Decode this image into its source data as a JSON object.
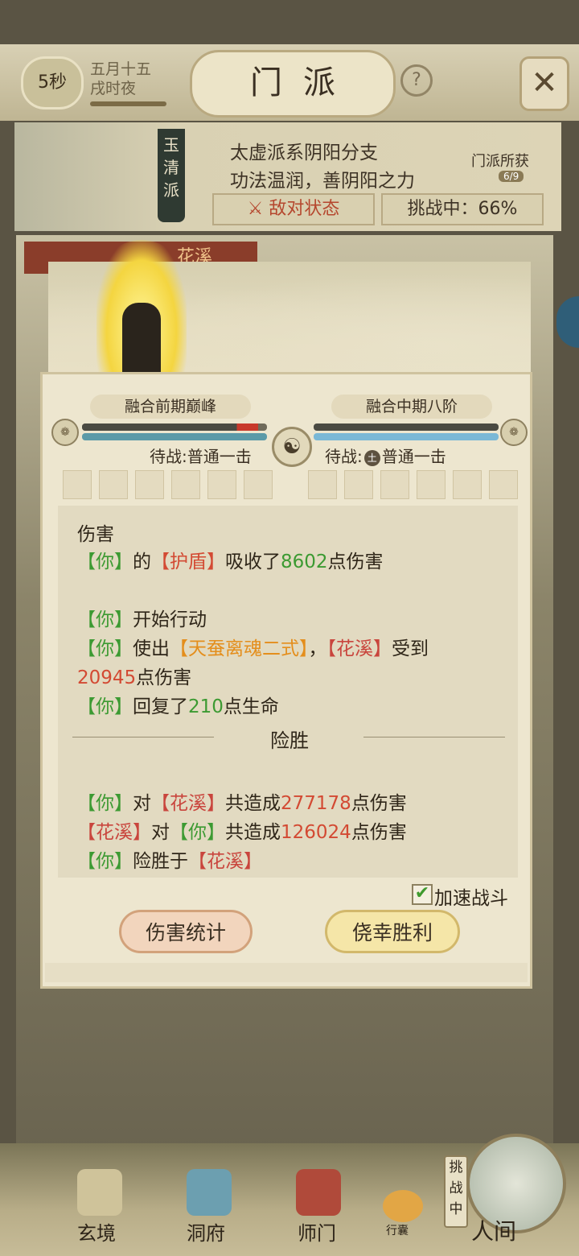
{
  "header": {
    "timer": "5秒",
    "date_line1": "五月十五",
    "date_line2": "戌时夜",
    "title": "门派",
    "help_label": "?",
    "close_label": "✕"
  },
  "sect": {
    "name_banner": "玉清派",
    "desc_line1": "太虚派系阴阳分支",
    "desc_line2": "功法温润，善阴阳之力",
    "reward_label": "门派所获",
    "reward_count": "6/9",
    "enemy_status": "敌对状态",
    "challenge_status": "挑战中：66%"
  },
  "enemy_tab": "花溪",
  "battle": {
    "left": {
      "realm": "融合前期巅峰",
      "avatar": "",
      "hp": 0.95,
      "mp": 1.0,
      "waiting": "待战:普通一击"
    },
    "right": {
      "realm": "融合中期八阶",
      "avatar": "",
      "hp": 1.0,
      "mp": 1.0,
      "waiting_prefix": "待战:",
      "waiting_tag": "土",
      "waiting_action": "普通一击"
    },
    "center_icon": "☯"
  },
  "log": {
    "l1": "伤害",
    "l2_a": "【你】",
    "l2_b": "的",
    "l2_c": "【护盾】",
    "l2_d": "吸收了",
    "l2_e": "8602",
    "l2_f": "点伤害",
    "l3_a": "【你】",
    "l3_b": "开始行动",
    "l4_a": "【你】",
    "l4_b": "使出",
    "l4_c": "【天蚕离魂二式】",
    "l4_d": "，",
    "l4_e": "【花溪】",
    "l4_f": "受到",
    "l5_a": "20945",
    "l5_b": "点伤害",
    "l6_a": "【你】",
    "l6_b": "回复了",
    "l6_c": "210",
    "l6_d": "点生命",
    "result": "险胜",
    "s1_a": "【你】",
    "s1_b": "对",
    "s1_c": "【花溪】",
    "s1_d": "共造成",
    "s1_e": "277178",
    "s1_f": "点伤害",
    "s2_a": "【花溪】",
    "s2_b": "对",
    "s2_c": "【你】",
    "s2_d": "共造成",
    "s2_e": "126024",
    "s2_f": "点伤害",
    "s3_a": "【你】",
    "s3_b": "险胜于",
    "s3_c": "【花溪】"
  },
  "controls": {
    "speed_checked": true,
    "speed_label": "加速战斗",
    "damage_stats": "伤害统计",
    "victory": "侥幸胜利"
  },
  "nav": {
    "items": [
      "玄境",
      "洞府",
      "师门",
      "人间"
    ],
    "bag": "行囊",
    "challenge_tag": "挑战中"
  },
  "colors": {
    "hp_fill": "#4a4a42",
    "hp_red": "#c8392b",
    "mp_fill": "#7ab8d6",
    "ally": "#3c9a32",
    "enemy": "#c9453d"
  }
}
